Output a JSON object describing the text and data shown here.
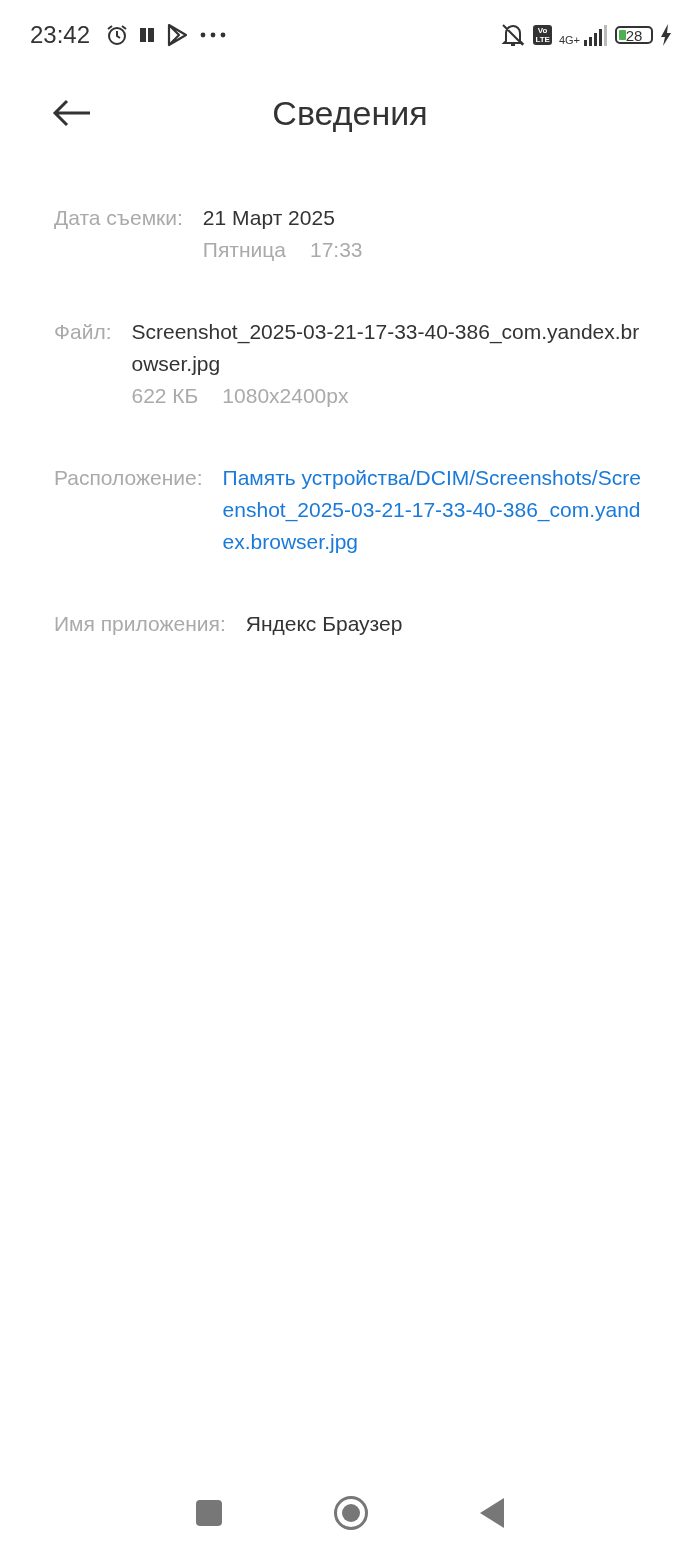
{
  "status_bar": {
    "time": "23:42",
    "volte_top": "Vo",
    "volte_bottom": "LTE",
    "network": "4G+",
    "battery": "28"
  },
  "header": {
    "title": "Сведения"
  },
  "details": [
    {
      "kind": "text",
      "label": "Дата съемки:",
      "value": "21 Март 2025",
      "extra": [
        "Пятница",
        "17:33"
      ]
    },
    {
      "kind": "text",
      "label": "Файл:",
      "value": "Screenshot_2025-03-21-17-33-40-386_com.yandex.browser.jpg",
      "extra": [
        "622 КБ",
        "1080x2400px"
      ]
    },
    {
      "kind": "link",
      "label": "Расположение:",
      "value": "Память устройства/DCIM/Screenshots/Screenshot_2025-03-21-17-33-40-386_com.yandex.browser.jpg"
    },
    {
      "kind": "text",
      "label": "Имя приложения:",
      "value": "Яндекс Браузер"
    }
  ]
}
